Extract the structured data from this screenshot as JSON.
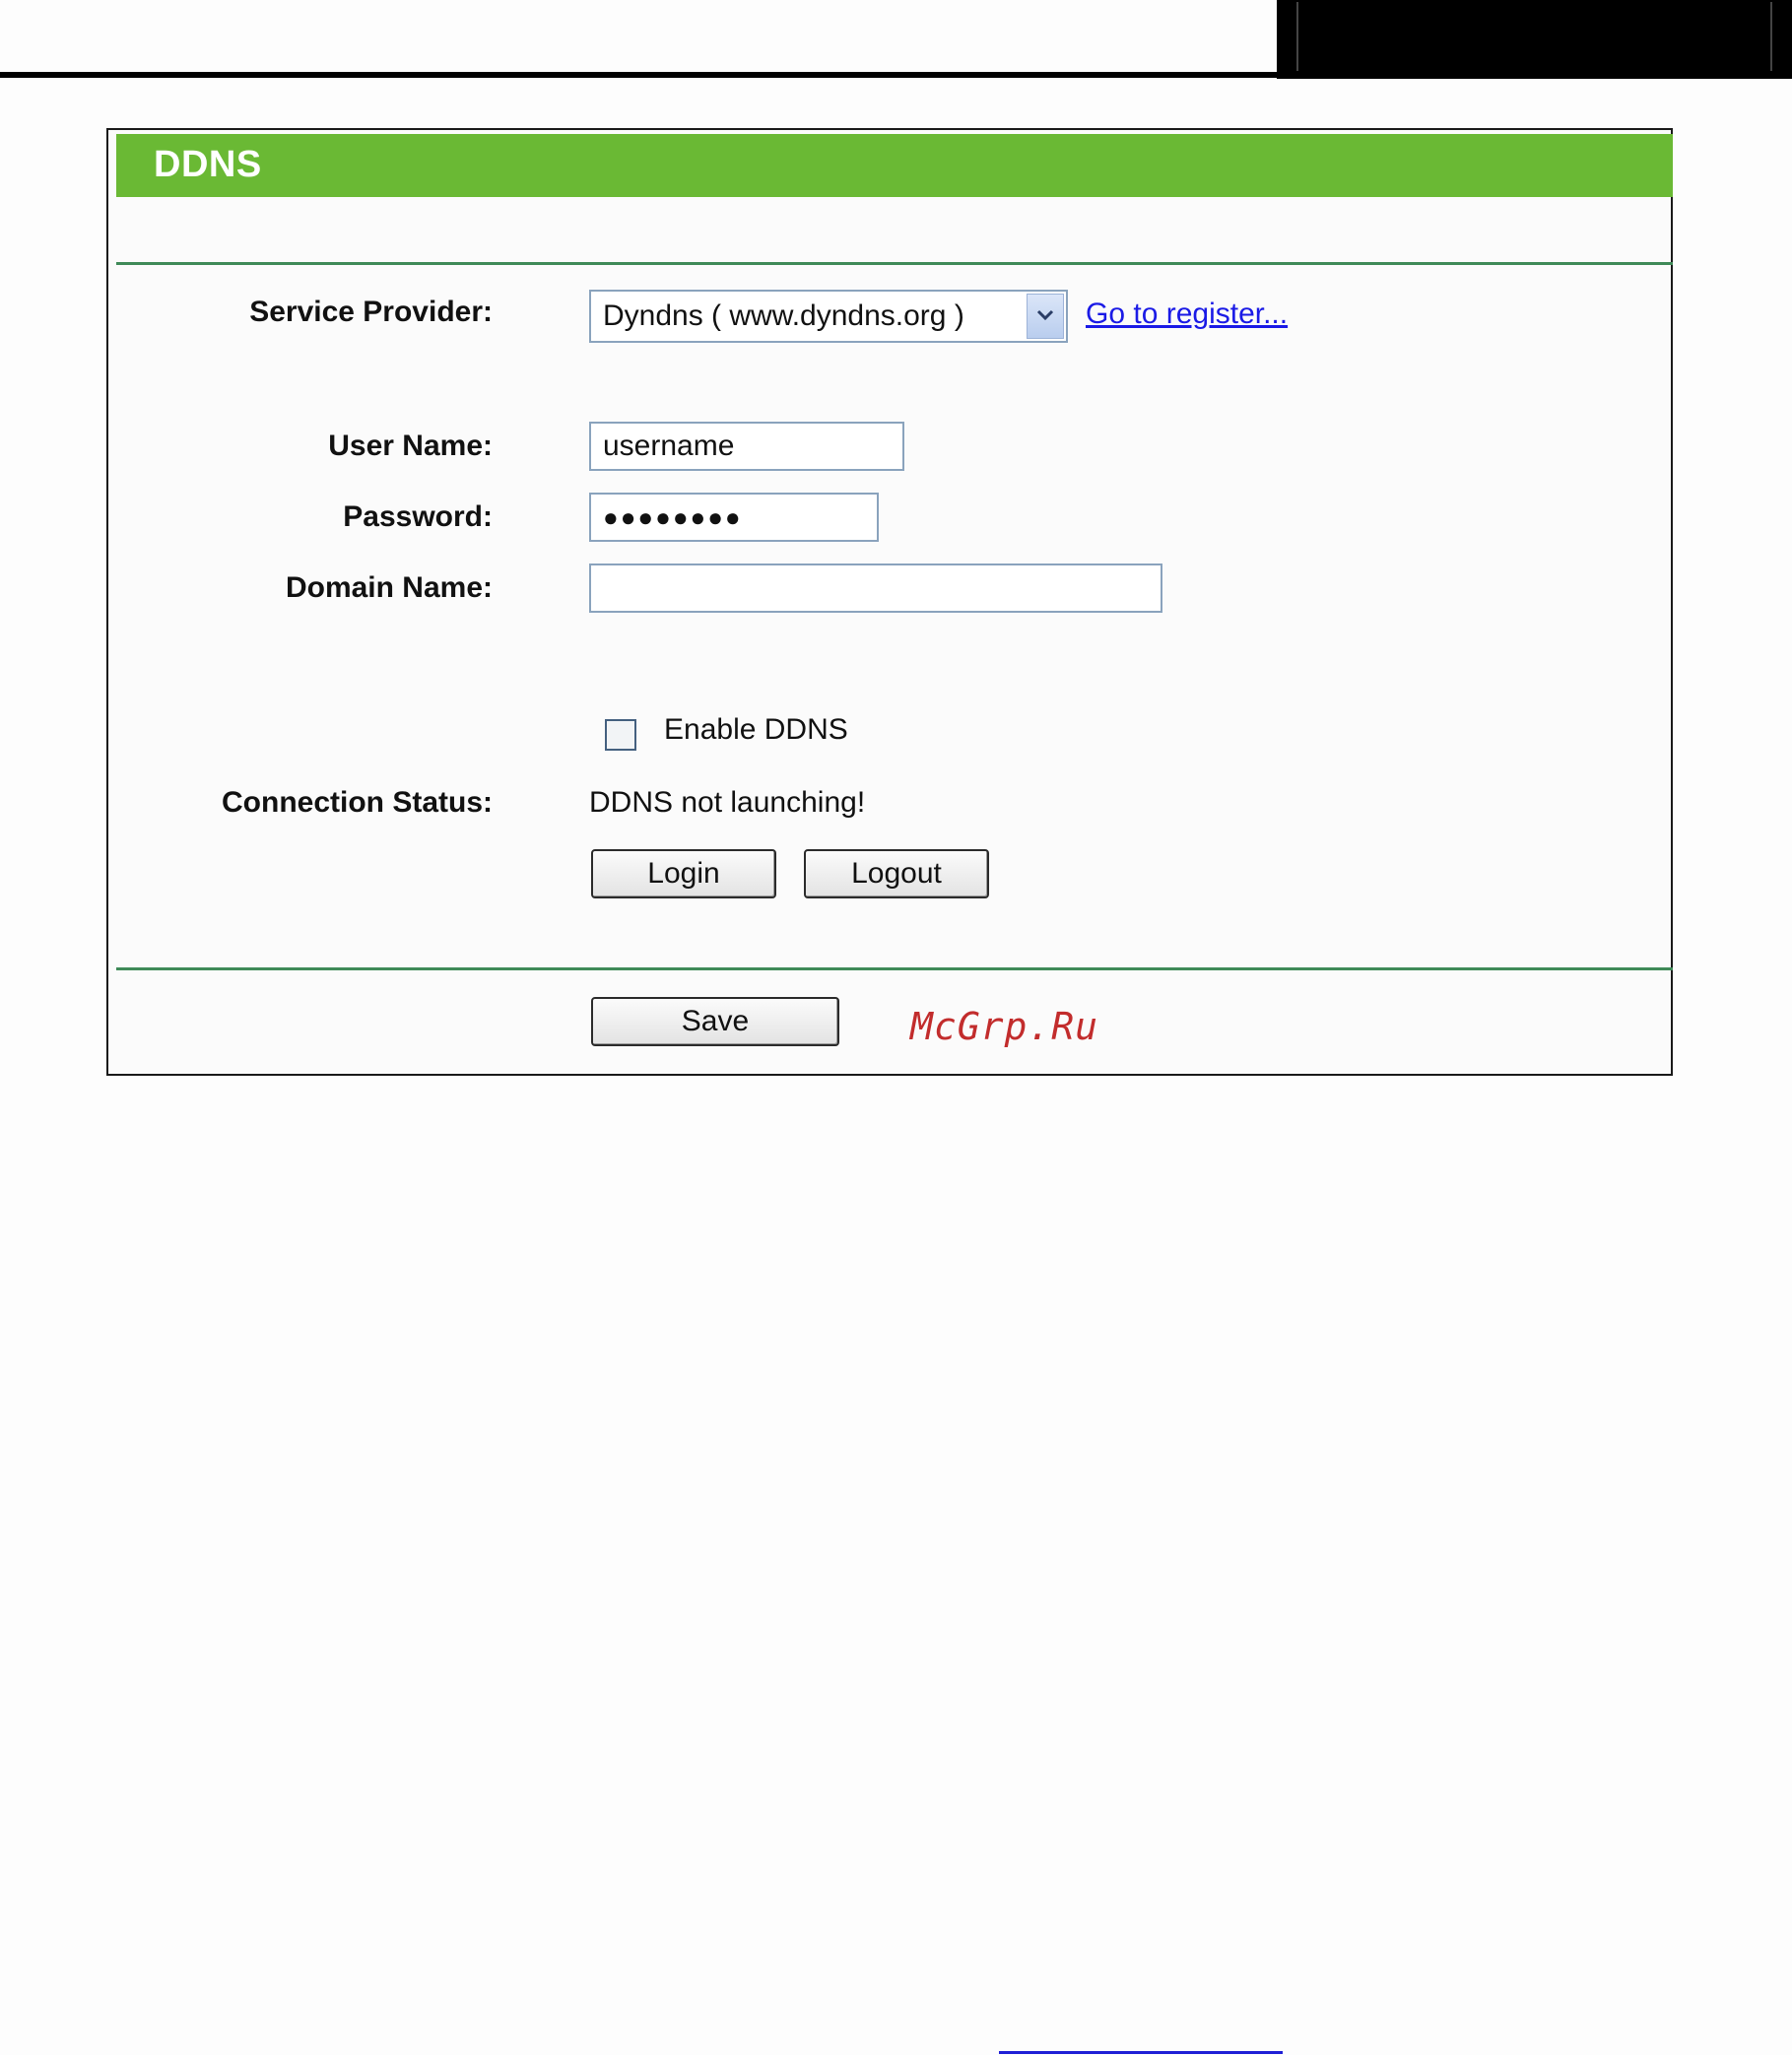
{
  "panel": {
    "title": "DDNS"
  },
  "form": {
    "service_provider": {
      "label": "Service Provider:",
      "selected": "Dyndns ( www.dyndns.org )",
      "register_link": "Go to register..."
    },
    "user_name": {
      "label": "User Name:",
      "value": "username"
    },
    "password": {
      "label": "Password:",
      "value": "●●●●●●●●"
    },
    "domain_name": {
      "label": "Domain Name:",
      "value": ""
    },
    "enable": {
      "label": "Enable DDNS",
      "checked": false
    },
    "connection_status": {
      "label": "Connection Status:",
      "value": "DDNS not launching!"
    }
  },
  "buttons": {
    "login": "Login",
    "logout": "Logout",
    "save": "Save"
  },
  "watermark": {
    "text": "McGrp.Ru"
  },
  "colors": {
    "header": "#6ab934",
    "divider": "#3f8a58",
    "link": "#1a1ae6",
    "watermark": "#c22c2c"
  },
  "icons": {
    "dropdown": "chevron-down-icon"
  }
}
